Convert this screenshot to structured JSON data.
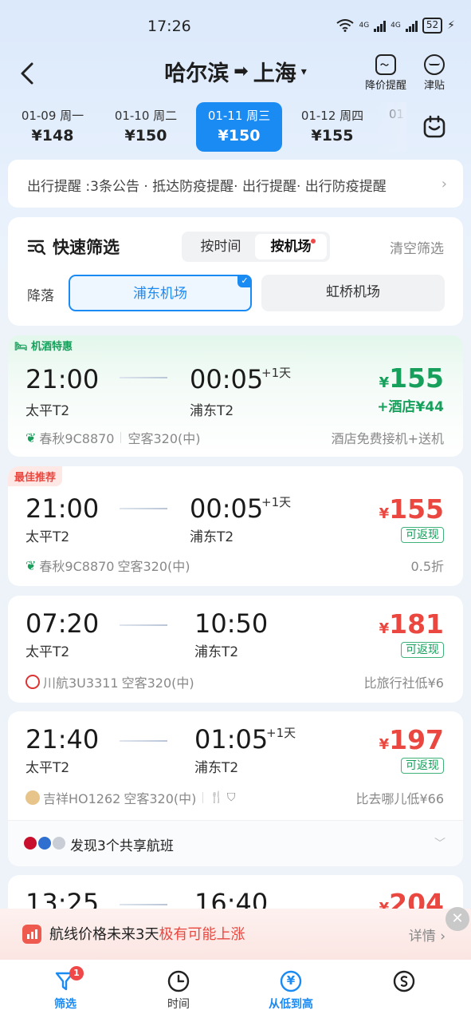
{
  "status": {
    "time": "17:26",
    "battery": "52",
    "net1": "4G",
    "net2": "4G"
  },
  "header": {
    "from": "哈尔滨",
    "arrow": "➡",
    "to": "上海",
    "caret": "▾",
    "price_alert": "降价提醒",
    "subsidy": "津贴"
  },
  "dates": [
    {
      "date": "01-09 周一",
      "price": "¥148"
    },
    {
      "date": "01-10 周二",
      "price": "¥150"
    },
    {
      "date": "01-11 周三",
      "price": "¥150"
    },
    {
      "date": "01-12 周四",
      "price": "¥155"
    },
    {
      "date": "01",
      "price": ""
    }
  ],
  "notice": {
    "text": "出行提醒 :3条公告 · 抵达防疫提醒· 出行提醒· 出行防疫提醒",
    "chevron": "›"
  },
  "filter": {
    "title": "快速筛选",
    "by_time": "按时间",
    "by_airport": "按机场",
    "clear": "清空筛选",
    "landing": "降落",
    "pudong": "浦东机场",
    "hongqiao": "虹桥机场",
    "check": "✓"
  },
  "flights": [
    {
      "tag": "机酒特惠",
      "dep_time": "21:00",
      "dep_term": "太平T2",
      "arr_time": "00:05",
      "plus": "+1天",
      "arr_term": "浦东T2",
      "currency": "¥",
      "price": "155",
      "hotel": "+酒店¥44",
      "airline": "春秋9C8870",
      "aircraft": "空客320(中)",
      "note": "酒店免费接机+送机"
    },
    {
      "tag": "最佳推荐",
      "dep_time": "21:00",
      "dep_term": "太平T2",
      "arr_time": "00:05",
      "plus": "+1天",
      "arr_term": "浦东T2",
      "currency": "¥",
      "price": "155",
      "cashback": "可返现",
      "airline": "春秋9C8870",
      "aircraft": "空客320(中)",
      "note": "0.5折"
    },
    {
      "dep_time": "07:20",
      "dep_term": "太平T2",
      "arr_time": "10:50",
      "arr_term": "浦东T2",
      "currency": "¥",
      "price": "181",
      "cashback": "可返现",
      "airline": "川航3U3311",
      "aircraft": "空客320(中)",
      "note": "比旅行社低¥6"
    },
    {
      "dep_time": "21:40",
      "dep_term": "太平T2",
      "arr_time": "01:05",
      "plus": "+1天",
      "arr_term": "浦东T2",
      "currency": "¥",
      "price": "197",
      "cashback": "可返现",
      "airline": "吉祥HO1262",
      "aircraft": "空客320(中)",
      "note": "比去哪儿低¥66",
      "share": "发现3个共享航班"
    },
    {
      "dep_time": "13:25",
      "arr_time": "16:40",
      "currency": "¥",
      "price": "204"
    }
  ],
  "alert": {
    "text_prefix": "航线价格未来3天",
    "text_highlight": "极有可能上涨",
    "detail": "详情 ›",
    "close": "✕"
  },
  "nav": {
    "filter": "筛选",
    "filter_badge": "1",
    "time": "时间",
    "low_high": "从低到高",
    "yen": "¥"
  },
  "colors": {
    "primary": "#1b8bf4",
    "price_red": "#e9473f",
    "green": "#16a05b"
  }
}
